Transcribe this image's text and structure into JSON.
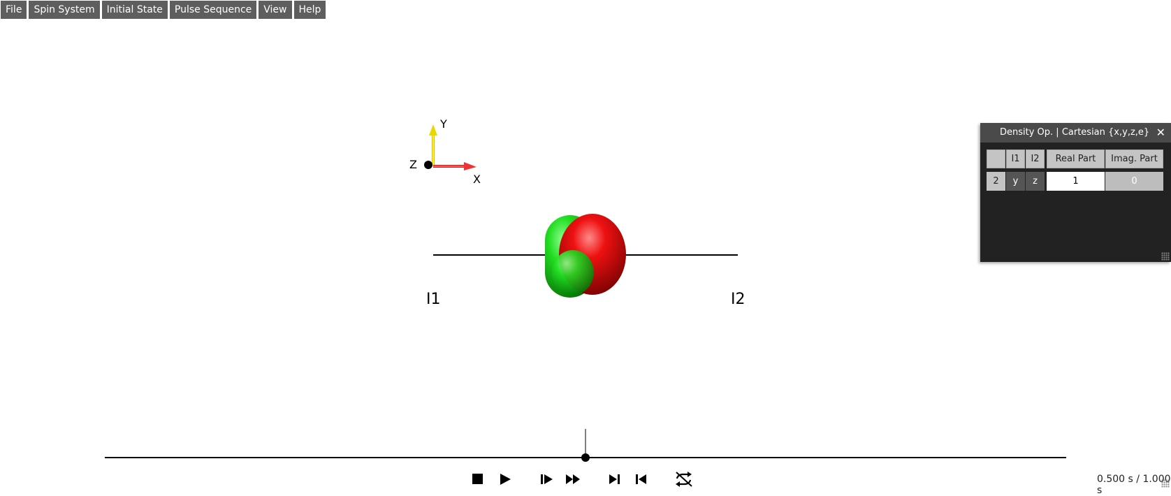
{
  "menu": {
    "items": [
      "File",
      "Spin System",
      "Initial State",
      "Pulse Sequence",
      "View",
      "Help"
    ]
  },
  "axes": {
    "x": "X",
    "y": "Y",
    "z": "Z"
  },
  "spins": {
    "left": "I1",
    "right": "I2"
  },
  "panel": {
    "title": "Density Op. | Cartesian {x,y,z,e}",
    "columns": {
      "blank": "",
      "i1": "I1",
      "i2": "I2",
      "real": "Real Part",
      "imag": "Imag. Part"
    },
    "row": {
      "index": "2",
      "i1": "y",
      "i2": "z",
      "real": "1",
      "imag": "0"
    }
  },
  "playback": {
    "time_label": "0.500 s / 1.000 s",
    "progress": 0.5
  },
  "colors": {
    "lobe_green": "#11cc11",
    "lobe_red": "#dd0000",
    "x_axis": "#ee3333",
    "y_axis": "#f4ee22"
  }
}
